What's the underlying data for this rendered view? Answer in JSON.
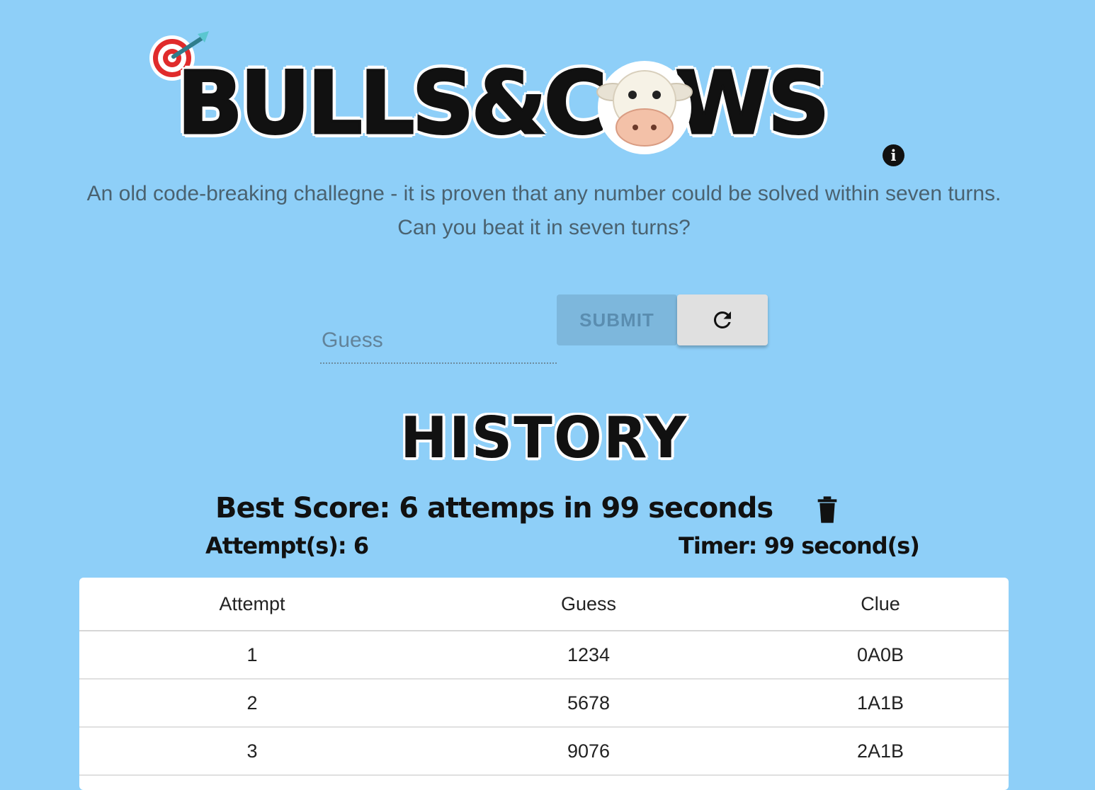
{
  "header": {
    "logo_text": "BULLS&COWS",
    "logo_icons": [
      "target-dart-icon",
      "cow-face-icon"
    ],
    "info_icon": "info-icon"
  },
  "subtitle": {
    "line1": "An old code-breaking challegne - it is proven that any number could be solved within seven turns.",
    "line2": "Can you beat it in seven turns?"
  },
  "form": {
    "guess_placeholder": "Guess",
    "guess_value": "",
    "submit_label": "SUBMIT",
    "refresh_icon": "refresh-icon"
  },
  "history": {
    "title": "HISTORY",
    "best_score": "Best Score: 6 attemps in 99 seconds",
    "attempts": "Attempt(s): 6",
    "timer": "Timer: 99 second(s)",
    "columns": [
      "Attempt",
      "Guess",
      "Clue"
    ],
    "rows": [
      [
        "1",
        "1234",
        "0A0B"
      ],
      [
        "2",
        "5678",
        "1A1B"
      ],
      [
        "3",
        "9076",
        "2A1B"
      ]
    ]
  },
  "colors": {
    "background": "#8ecff8",
    "submit_disabled": "#7db7dc",
    "text_dark": "#111111"
  }
}
